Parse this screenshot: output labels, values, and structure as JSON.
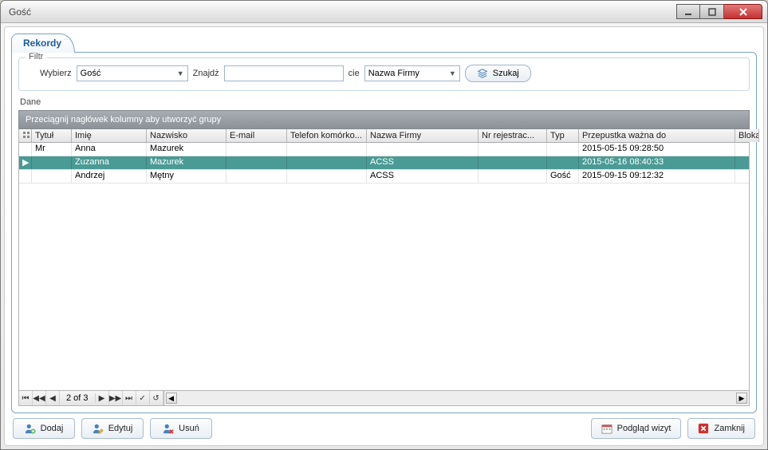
{
  "window": {
    "title": "Gość"
  },
  "tabs": {
    "records": "Rekordy"
  },
  "filter": {
    "legend": "Filtr",
    "wybierz_label": "Wybierz",
    "wybierz_value": "Gość",
    "znajdz_label": "Znajdż",
    "znajdz_value": "",
    "cie_label": "cie",
    "field_value": "Nazwa Firmy",
    "szukaj_label": "Szukaj"
  },
  "dane_label": "Dane",
  "group_drop_hint": "Przeciągnij nagłówek kolumny aby utworzyć grupy",
  "columns": {
    "tytul": "Tytuł",
    "imie": "Imię",
    "nazwisko": "Nazwisko",
    "email": "E-mail",
    "telefon": "Telefon komórko...",
    "firma": "Nazwa Firmy",
    "nrrej": "Nr rejestrac...",
    "typ": "Typ",
    "przepustka": "Przepustka ważna do",
    "blokada": "Blokada"
  },
  "rows": [
    {
      "tytul": "Mr",
      "imie": "Anna",
      "nazwisko": "Mazurek",
      "email": "",
      "telefon": "",
      "firma": "",
      "nrrej": "",
      "typ": "",
      "przepustka": "2015-05-15 09:28:50",
      "blokada": "0",
      "selected": false
    },
    {
      "tytul": "",
      "imie": "Zuzanna",
      "nazwisko": "Mazurek",
      "email": "",
      "telefon": "",
      "firma": "ACSS",
      "nrrej": "",
      "typ": "",
      "przepustka": "2015-05-16 08:40:33",
      "blokada": "0",
      "selected": true
    },
    {
      "tytul": "",
      "imie": "Andrzej",
      "nazwisko": "Mętny",
      "email": "",
      "telefon": "",
      "firma": "ACSS",
      "nrrej": "",
      "typ": "Gość",
      "przepustka": "2015-09-15 09:12:32",
      "blokada": "0",
      "selected": false
    }
  ],
  "navigator": {
    "position": "2 of 3"
  },
  "buttons": {
    "dodaj": "Dodaj",
    "edytuj": "Edytuj",
    "usun": "Usuń",
    "podglad": "Podgląd wizyt",
    "zamknij": "Zamknij"
  }
}
